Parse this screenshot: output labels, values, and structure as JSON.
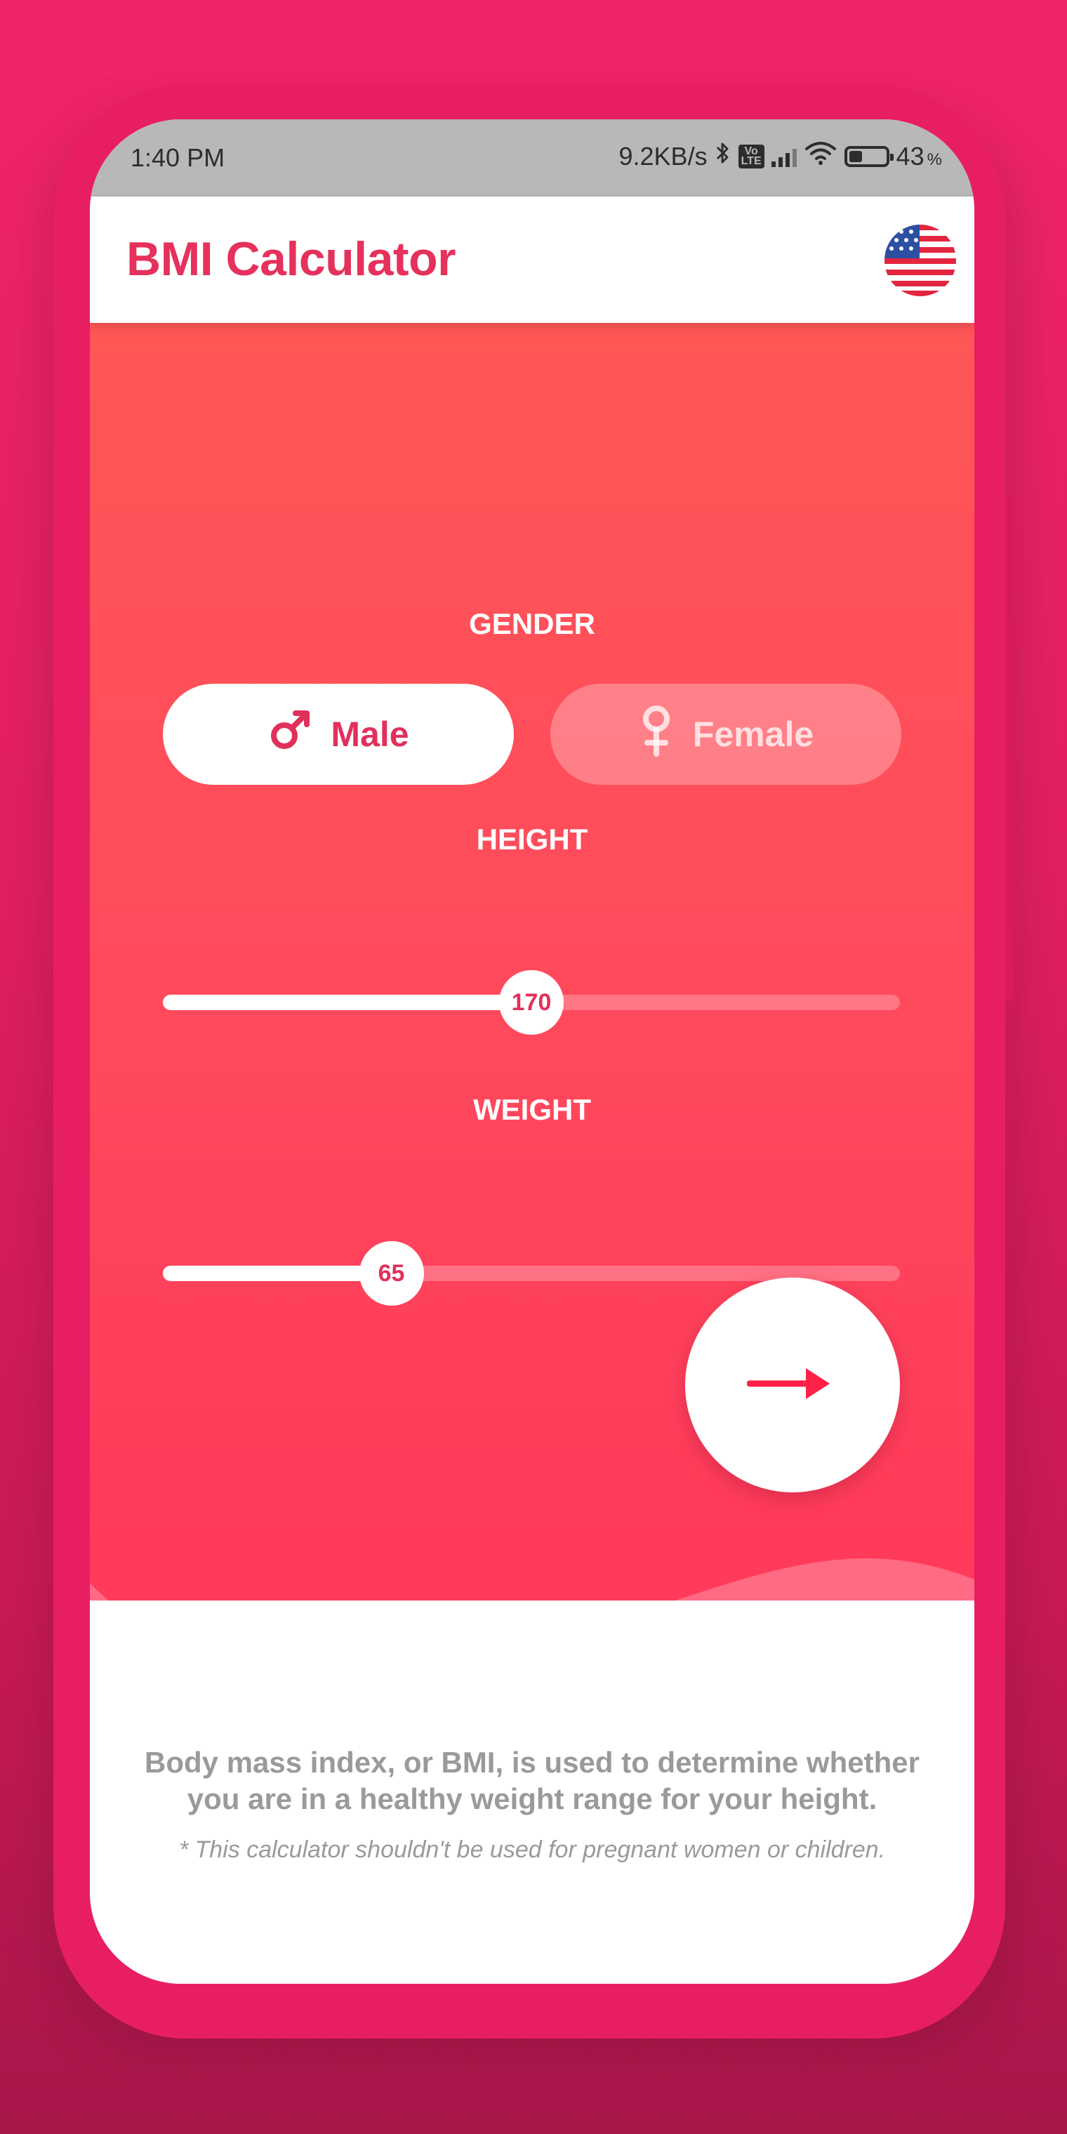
{
  "status_bar": {
    "time": "1:40 PM",
    "network_speed": "9.2KB/s",
    "volte_label": "Vo\nLTE",
    "battery_percent": "43",
    "battery_unit": "%",
    "battery_level": 0.43
  },
  "app_bar": {
    "title": "BMI Calculator",
    "language_icon": "us-flag-icon"
  },
  "gender": {
    "label": "GENDER",
    "options": [
      {
        "label": "Male",
        "icon": "male-icon",
        "selected": true
      },
      {
        "label": "Female",
        "icon": "female-icon",
        "selected": false
      }
    ]
  },
  "height": {
    "label": "HEIGHT",
    "value": "170",
    "fill_fraction": 0.5
  },
  "weight": {
    "label": "WEIGHT",
    "value": "65",
    "fill_fraction": 0.31
  },
  "next_button": {
    "icon": "arrow-right-icon"
  },
  "info": {
    "description": "Body mass index, or BMI, is used to determine whether you are in a healthy weight range for your height.",
    "note": "* This calculator shouldn't be used for pregnant women or children."
  },
  "colors": {
    "accent": "#e0315b",
    "gradient_top": "#ff5656",
    "gradient_bottom": "#ff3358",
    "frame": "#e81e63",
    "muted_text": "#9a9a9a"
  }
}
